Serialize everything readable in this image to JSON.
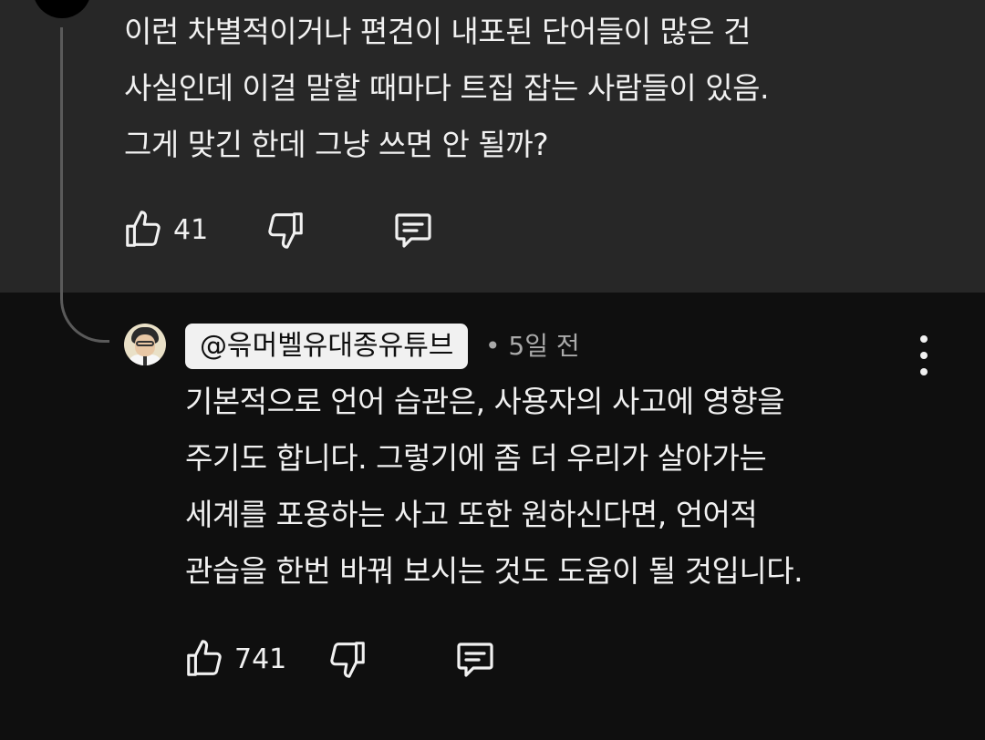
{
  "parent_comment": {
    "text": "이런 차별적이거나 편견이 내포된 단어들이 많은 건\n사실인데 이걸 말할 때마다 트집 잡는 사람들이 있음.\n그게 맞긴 한데 그냥 쓰면 안 될까?",
    "like_count": "41",
    "icons": {
      "like": "thumbs-up-icon",
      "dislike": "thumbs-down-icon",
      "reply": "comment-reply-icon"
    }
  },
  "reply": {
    "author": "@윾머벨유대종유튜브",
    "time": "• 5일 전",
    "text": "기본적으로 언어 습관은, 사용자의 사고에 영향을\n주기도 합니다. 그렇기에 좀 더 우리가 살아가는\n세계를 포용하는 사고 또한 원하신다면, 언어적\n관습을 한번 바꿔 보시는 것도 도움이 될 것입니다.",
    "like_count": "741",
    "icons": {
      "like": "thumbs-up-icon",
      "dislike": "thumbs-down-icon",
      "reply": "comment-reply-icon",
      "menu": "more-vert-icon"
    }
  },
  "colors": {
    "parent_bg": "#272727",
    "page_bg": "#0f0f0f",
    "text": "#f1f1f1",
    "meta": "#aaaaaa",
    "chip_bg": "#f1f1f1"
  }
}
